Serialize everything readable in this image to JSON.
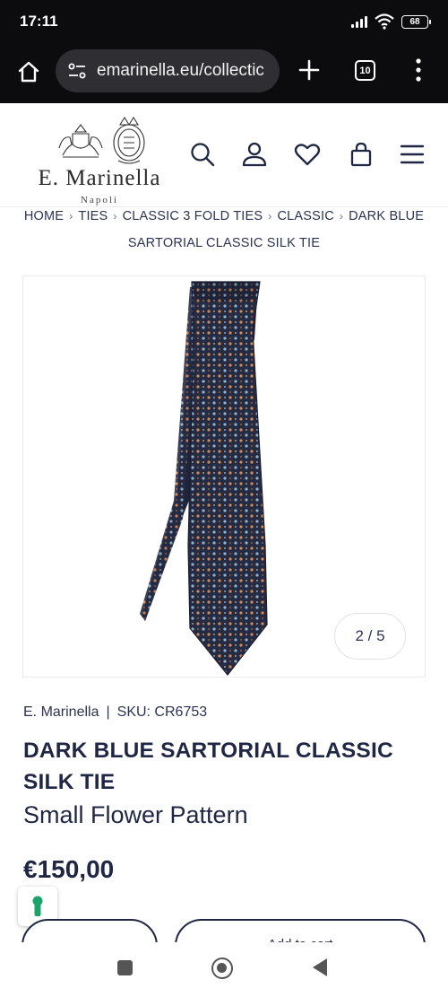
{
  "status_bar": {
    "time": "17:11",
    "battery": "68"
  },
  "browser": {
    "url": "emarinella.eu/collectic",
    "tab_count": "10"
  },
  "header": {
    "logo_name": "E. Marinella",
    "logo_sub": "Napoli",
    "icons": [
      "search-icon",
      "account-icon",
      "wishlist-icon",
      "bag-icon",
      "menu-icon"
    ]
  },
  "breadcrumb": {
    "items": [
      "HOME",
      "TIES",
      "CLASSIC 3 FOLD TIES",
      "CLASSIC",
      "DARK BLUE SARTORIAL CLASSIC SILK TIE"
    ]
  },
  "gallery": {
    "counter": "2 / 5"
  },
  "product": {
    "brand": "E. Marinella",
    "sku_label": "SKU: CR6753",
    "title": "DARK BLUE SARTORIAL CLASSIC SILK TIE",
    "subtitle": "Small Flower Pattern",
    "price": "€150,00",
    "add_to_cart": "Add to cart"
  },
  "colors": {
    "brand_navy": "#1f2744",
    "browser_dark": "#0c0c0e",
    "side_tab_accent": "#1aa36b"
  }
}
